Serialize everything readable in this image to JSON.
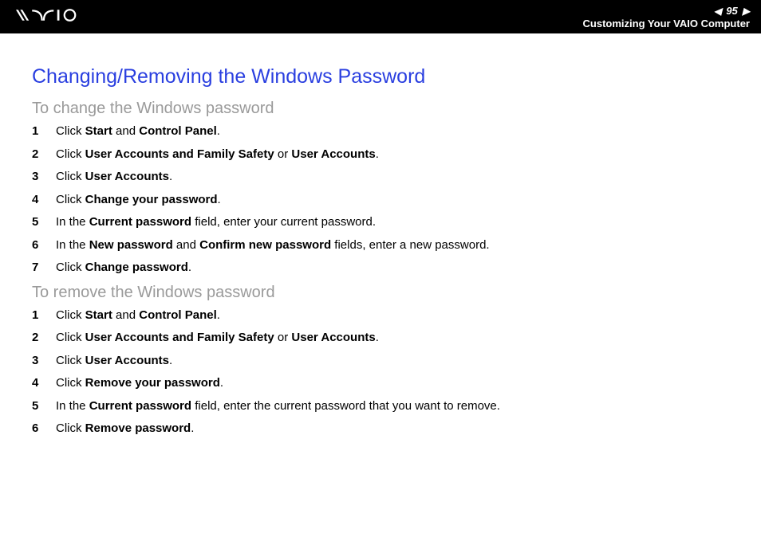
{
  "header": {
    "page_number": "95",
    "section": "Customizing Your VAIO Computer"
  },
  "title": "Changing/Removing the Windows Password",
  "section_change": {
    "heading": "To change the Windows password",
    "steps": [
      {
        "n": "1",
        "parts": [
          "Click ",
          {
            "b": "Start"
          },
          " and ",
          {
            "b": "Control Panel"
          },
          "."
        ]
      },
      {
        "n": "2",
        "parts": [
          "Click ",
          {
            "b": "User Accounts and Family Safety"
          },
          " or ",
          {
            "b": "User Accounts"
          },
          "."
        ]
      },
      {
        "n": "3",
        "parts": [
          "Click ",
          {
            "b": "User Accounts"
          },
          "."
        ]
      },
      {
        "n": "4",
        "parts": [
          "Click ",
          {
            "b": "Change your password"
          },
          "."
        ]
      },
      {
        "n": "5",
        "parts": [
          "In the ",
          {
            "b": "Current password"
          },
          " field, enter your current password."
        ]
      },
      {
        "n": "6",
        "parts": [
          "In the ",
          {
            "b": "New password"
          },
          " and ",
          {
            "b": "Confirm new password"
          },
          " fields, enter a new password."
        ]
      },
      {
        "n": "7",
        "parts": [
          "Click ",
          {
            "b": "Change password"
          },
          "."
        ]
      }
    ]
  },
  "section_remove": {
    "heading": "To remove the Windows password",
    "steps": [
      {
        "n": "1",
        "parts": [
          "Click ",
          {
            "b": "Start"
          },
          " and ",
          {
            "b": "Control Panel"
          },
          "."
        ]
      },
      {
        "n": "2",
        "parts": [
          "Click ",
          {
            "b": "User Accounts and Family Safety"
          },
          " or ",
          {
            "b": "User Accounts"
          },
          "."
        ]
      },
      {
        "n": "3",
        "parts": [
          "Click ",
          {
            "b": "User Accounts"
          },
          "."
        ]
      },
      {
        "n": "4",
        "parts": [
          "Click ",
          {
            "b": "Remove your password"
          },
          "."
        ]
      },
      {
        "n": "5",
        "parts": [
          "In the ",
          {
            "b": "Current password"
          },
          " field, enter the current password that you want to remove."
        ]
      },
      {
        "n": "6",
        "parts": [
          "Click ",
          {
            "b": "Remove password"
          },
          "."
        ]
      }
    ]
  }
}
